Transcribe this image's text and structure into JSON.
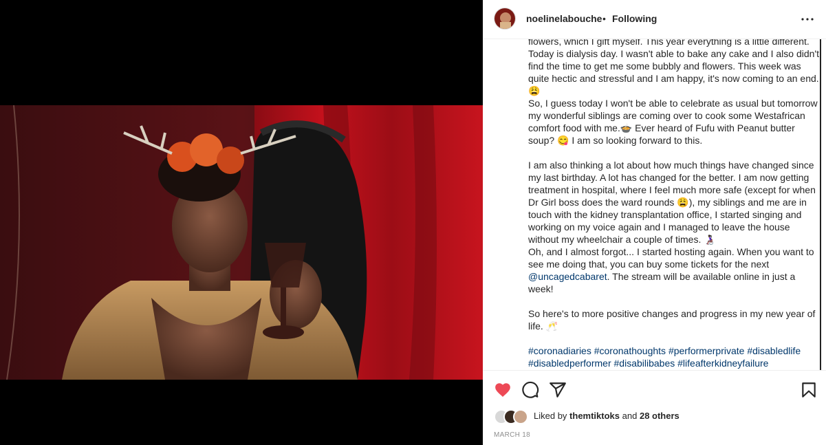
{
  "post": {
    "username": "noelinelabouche",
    "separator": "•",
    "follow_status": "Following",
    "caption": {
      "p1": "flowers, which I gift myself. This year everything is a little different. Today is dialysis day. I wasn't able to bake any cake and I also didn't find the time to get me some bubbly and flowers. This week was quite hectic and stressful and I am happy, it's now coming to an end. 😩",
      "p2": "So, I guess today I won't be able to celebrate as usual but tomorrow my wonderful siblings are coming over to cook some Westafrican comfort food with me.🍲 Ever heard of Fufu with Peanut butter soup? 😋 I am so looking forward to this.",
      "p3": "I am also thinking a lot about how much things have changed since my last birthday. A lot has changed for the better. I am now getting treatment in hospital, where I feel much more safe (except for when Dr Girl boss does the ward rounds 😩), my siblings and me are in touch with the kidney transplantation office, I started singing and working on my voice again and I managed to leave the house without my wheelchair a couple of times. 👩🏿‍🦽",
      "p4_before": "Oh, and I almost forgot... I started hosting again. When you want to see me doing that, you can buy some tickets for the next ",
      "p4_mention": "@uncagedcabaret",
      "p4_after": ". The stream will be available online in just a week!",
      "p5": "So here's to more positive changes and progress in my new year of life. 🥂",
      "hashtags": [
        "#coronadiaries",
        "#coronathoughts",
        "#performerprivate",
        "#disabledlife",
        "#disabledperformer",
        "#disabilibabes",
        "#lifeafterkidneyfailure"
      ]
    },
    "likes": {
      "prefix": "Liked by",
      "user": "themtiktoks",
      "conj": "and",
      "others": "28 others"
    },
    "date": "MARCH 18",
    "icons": {
      "like": "heart-icon",
      "comment": "comment-icon",
      "share": "share-icon",
      "save": "bookmark-icon",
      "more": "more-options-icon"
    },
    "colors": {
      "like_red": "#ed4956",
      "link_blue": "#00376b",
      "text": "#262626",
      "muted": "#8e8e8e"
    }
  }
}
